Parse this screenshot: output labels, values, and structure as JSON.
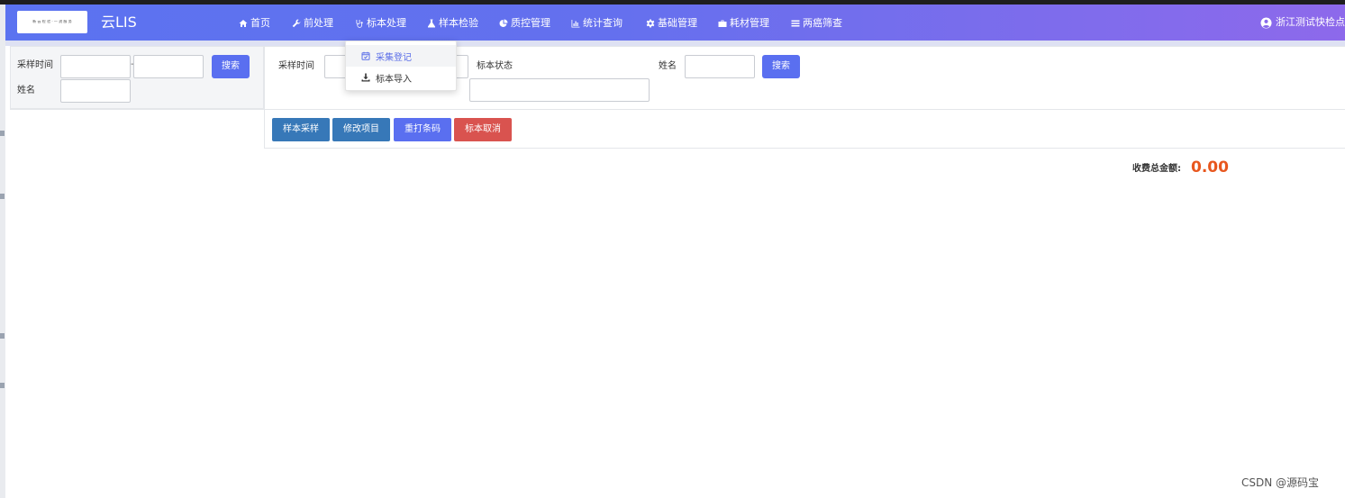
{
  "navbar": {
    "logo_text": "新 云 检 验 · 一 流 服 务",
    "brand": "云LIS",
    "items": [
      {
        "label": "首页",
        "icon": "home-icon"
      },
      {
        "label": "前处理",
        "icon": "wrench-icon"
      },
      {
        "label": "标本处理",
        "icon": "stethoscope-icon"
      },
      {
        "label": "样本检验",
        "icon": "flask-icon"
      },
      {
        "label": "质控管理",
        "icon": "pie-chart-icon"
      },
      {
        "label": "统计查询",
        "icon": "bar-chart-icon"
      },
      {
        "label": "基础管理",
        "icon": "gear-icon"
      },
      {
        "label": "耗材管理",
        "icon": "briefcase-icon"
      },
      {
        "label": "两癌筛查",
        "icon": "list-icon"
      }
    ],
    "user": "浙江测试快检点"
  },
  "dropdown": {
    "items": [
      {
        "label": "采集登记",
        "icon": "calendar-check-icon"
      },
      {
        "label": "标本导入",
        "icon": "download-icon"
      }
    ]
  },
  "left_filter": {
    "sample_time_label": "采样时间",
    "range_sep": "-",
    "name_label": "姓名",
    "search_label": "搜索"
  },
  "right_filter": {
    "sample_time_label": "采样时间",
    "status_label": "标本状态",
    "name_label": "姓名",
    "search_label": "搜索"
  },
  "actions": [
    {
      "label": "样本采样",
      "color": "#3778b8"
    },
    {
      "label": "修改项目",
      "color": "#3778b8"
    },
    {
      "label": "重打条码",
      "color": "#5a6ff0"
    },
    {
      "label": "标本取消",
      "color": "#d9534f"
    }
  ],
  "fee": {
    "label": "收费总金额:",
    "value": "0.00"
  },
  "watermark": "CSDN @源码宝"
}
